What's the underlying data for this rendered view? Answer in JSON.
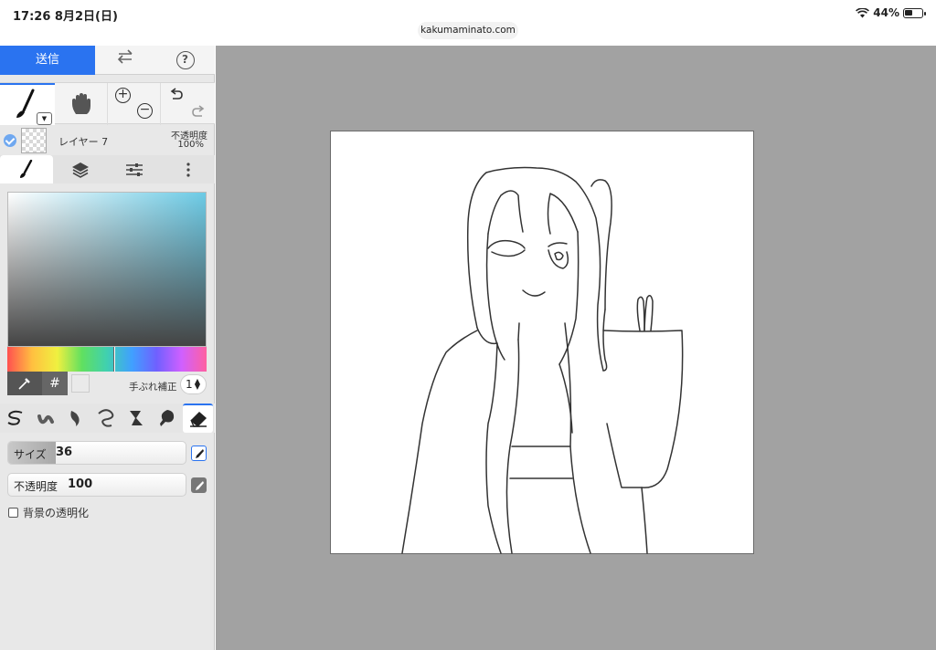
{
  "status": {
    "time": "17:26  8月2日(日)",
    "battery": "44%",
    "url": "kakumaminato.com"
  },
  "topbar": {
    "send_label": "送信",
    "swap_icon": "swap-icon",
    "help_label": "?"
  },
  "tools": {
    "active": "brush",
    "items": [
      "brush-icon",
      "hand-icon",
      "zoom-in-icon",
      "zoom-out-icon",
      "undo-icon",
      "redo-icon"
    ]
  },
  "layer": {
    "name": "レイヤー 7",
    "opacity_label": "不透明度",
    "opacity_value": "100%",
    "visible": true
  },
  "panel_tabs": [
    "brush-tab-icon",
    "layers-icon",
    "sliders-icon",
    "more-icon"
  ],
  "color": {
    "hue_accent": "#6ccbe6",
    "hex_label": "#",
    "stabilizer_label": "手ぶれ補正",
    "stabilizer_value": "1"
  },
  "brushes": [
    "pen-brush-icon",
    "airbrush-icon",
    "watercolor-icon",
    "blur-icon",
    "smudge-icon",
    "fill-brush-icon",
    "eraser-icon"
  ],
  "size": {
    "label": "サイズ",
    "value": "36",
    "fraction": 0.27
  },
  "opacity": {
    "label": "不透明度",
    "value": "100",
    "fraction": 0.0
  },
  "bg_transparent": {
    "label": "背景の透明化",
    "checked": false
  },
  "accent": "#2a73f0"
}
